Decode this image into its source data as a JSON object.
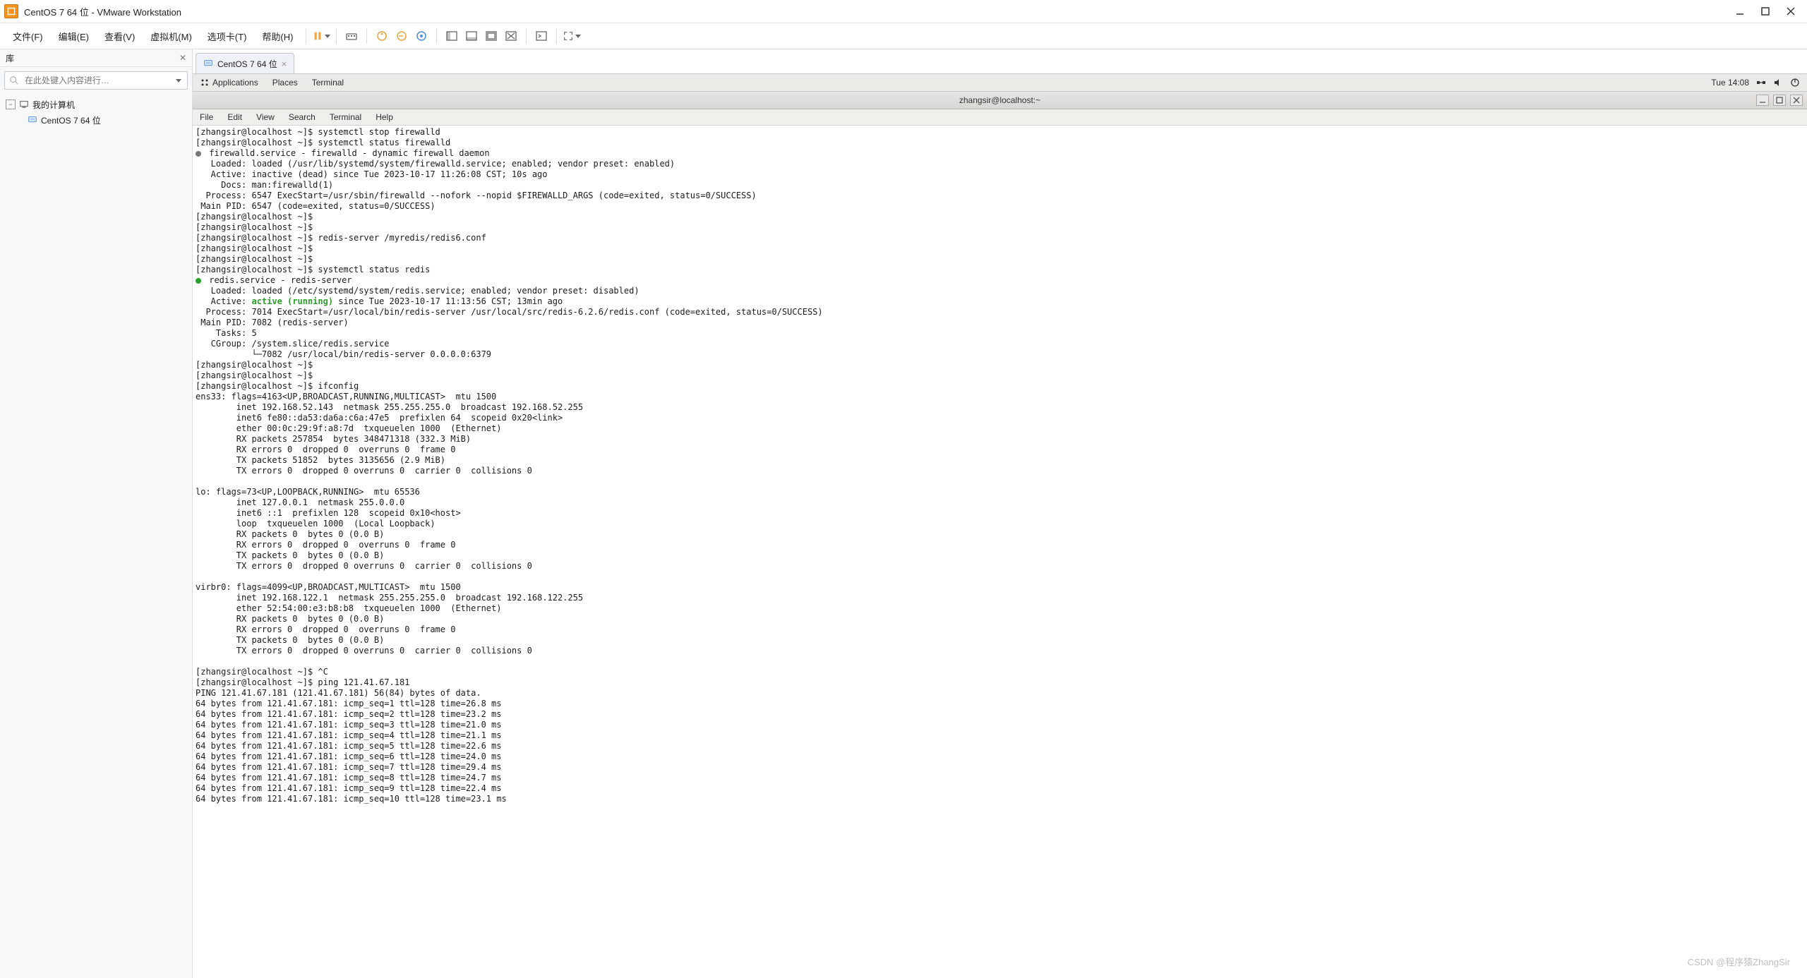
{
  "vmware": {
    "title": "CentOS 7 64 位 - VMware Workstation",
    "menu": [
      "文件(F)",
      "编辑(E)",
      "查看(V)",
      "虚拟机(M)",
      "选项卡(T)",
      "帮助(H)"
    ],
    "sidebar": {
      "header": "库",
      "search_placeholder": "在此处键入内容进行…",
      "root": "我的计算机",
      "child": "CentOS 7 64 位"
    },
    "tab": {
      "label": "CentOS 7 64 位"
    }
  },
  "gnome": {
    "apps": "Applications",
    "places": "Places",
    "terminal": "Terminal",
    "clock": "Tue 14:08"
  },
  "term_window": {
    "title": "zhangsir@localhost:~",
    "menu": [
      "File",
      "Edit",
      "View",
      "Search",
      "Terminal",
      "Help"
    ]
  },
  "terminal": {
    "l01": "[zhangsir@localhost ~]$ systemctl stop firewalld",
    "l02": "[zhangsir@localhost ~]$ systemctl status firewalld",
    "l03": " firewalld.service - firewalld - dynamic firewall daemon",
    "l04": "   Loaded: loaded (/usr/lib/systemd/system/firewalld.service; enabled; vendor preset: enabled)",
    "l05": "   Active: inactive (dead) since Tue 2023-10-17 11:26:08 CST; 10s ago",
    "l06": "     Docs: man:firewalld(1)",
    "l07": "  Process: 6547 ExecStart=/usr/sbin/firewalld --nofork --nopid $FIREWALLD_ARGS (code=exited, status=0/SUCCESS)",
    "l08": " Main PID: 6547 (code=exited, status=0/SUCCESS)",
    "l09": "[zhangsir@localhost ~]$ ",
    "l10": "[zhangsir@localhost ~]$ ",
    "l11": "[zhangsir@localhost ~]$ redis-server /myredis/redis6.conf",
    "l12": "[zhangsir@localhost ~]$ ",
    "l13": "[zhangsir@localhost ~]$ ",
    "l14": "[zhangsir@localhost ~]$ systemctl status redis",
    "l15": " redis.service - redis-server",
    "l16": "   Loaded: loaded (/etc/systemd/system/redis.service; enabled; vendor preset: disabled)",
    "l17a": "   Active: ",
    "l17b": "active (running)",
    "l17c": " since Tue 2023-10-17 11:13:56 CST; 13min ago",
    "l18": "  Process: 7014 ExecStart=/usr/local/bin/redis-server /usr/local/src/redis-6.2.6/redis.conf (code=exited, status=0/SUCCESS)",
    "l19": " Main PID: 7082 (redis-server)",
    "l20": "    Tasks: 5",
    "l21": "   CGroup: /system.slice/redis.service",
    "l22": "           └─7082 /usr/local/bin/redis-server 0.0.0.0:6379",
    "l23": "[zhangsir@localhost ~]$ ",
    "l24": "[zhangsir@localhost ~]$ ",
    "l25": "[zhangsir@localhost ~]$ ifconfig",
    "l26": "ens33: flags=4163<UP,BROADCAST,RUNNING,MULTICAST>  mtu 1500",
    "l27": "        inet 192.168.52.143  netmask 255.255.255.0  broadcast 192.168.52.255",
    "l28": "        inet6 fe80::da53:da6a:c6a:47e5  prefixlen 64  scopeid 0x20<link>",
    "l29": "        ether 00:0c:29:9f:a8:7d  txqueuelen 1000  (Ethernet)",
    "l30": "        RX packets 257854  bytes 348471318 (332.3 MiB)",
    "l31": "        RX errors 0  dropped 0  overruns 0  frame 0",
    "l32": "        TX packets 51852  bytes 3135656 (2.9 MiB)",
    "l33": "        TX errors 0  dropped 0 overruns 0  carrier 0  collisions 0",
    "l34": "",
    "l35": "lo: flags=73<UP,LOOPBACK,RUNNING>  mtu 65536",
    "l36": "        inet 127.0.0.1  netmask 255.0.0.0",
    "l37": "        inet6 ::1  prefixlen 128  scopeid 0x10<host>",
    "l38": "        loop  txqueuelen 1000  (Local Loopback)",
    "l39": "        RX packets 0  bytes 0 (0.0 B)",
    "l40": "        RX errors 0  dropped 0  overruns 0  frame 0",
    "l41": "        TX packets 0  bytes 0 (0.0 B)",
    "l42": "        TX errors 0  dropped 0 overruns 0  carrier 0  collisions 0",
    "l43": "",
    "l44": "virbr0: flags=4099<UP,BROADCAST,MULTICAST>  mtu 1500",
    "l45": "        inet 192.168.122.1  netmask 255.255.255.0  broadcast 192.168.122.255",
    "l46": "        ether 52:54:00:e3:b8:b8  txqueuelen 1000  (Ethernet)",
    "l47": "        RX packets 0  bytes 0 (0.0 B)",
    "l48": "        RX errors 0  dropped 0  overruns 0  frame 0",
    "l49": "        TX packets 0  bytes 0 (0.0 B)",
    "l50": "        TX errors 0  dropped 0 overruns 0  carrier 0  collisions 0",
    "l51": "",
    "l52": "[zhangsir@localhost ~]$ ^C",
    "l53": "[zhangsir@localhost ~]$ ping 121.41.67.181",
    "l54": "PING 121.41.67.181 (121.41.67.181) 56(84) bytes of data.",
    "l55": "64 bytes from 121.41.67.181: icmp_seq=1 ttl=128 time=26.8 ms",
    "l56": "64 bytes from 121.41.67.181: icmp_seq=2 ttl=128 time=23.2 ms",
    "l57": "64 bytes from 121.41.67.181: icmp_seq=3 ttl=128 time=21.0 ms",
    "l58": "64 bytes from 121.41.67.181: icmp_seq=4 ttl=128 time=21.1 ms",
    "l59": "64 bytes from 121.41.67.181: icmp_seq=5 ttl=128 time=22.6 ms",
    "l60": "64 bytes from 121.41.67.181: icmp_seq=6 ttl=128 time=24.0 ms",
    "l61": "64 bytes from 121.41.67.181: icmp_seq=7 ttl=128 time=29.4 ms",
    "l62": "64 bytes from 121.41.67.181: icmp_seq=8 ttl=128 time=24.7 ms",
    "l63": "64 bytes from 121.41.67.181: icmp_seq=9 ttl=128 time=22.4 ms",
    "l64": "64 bytes from 121.41.67.181: icmp_seq=10 ttl=128 time=23.1 ms"
  },
  "watermark": "CSDN @程序猿ZhangSir"
}
